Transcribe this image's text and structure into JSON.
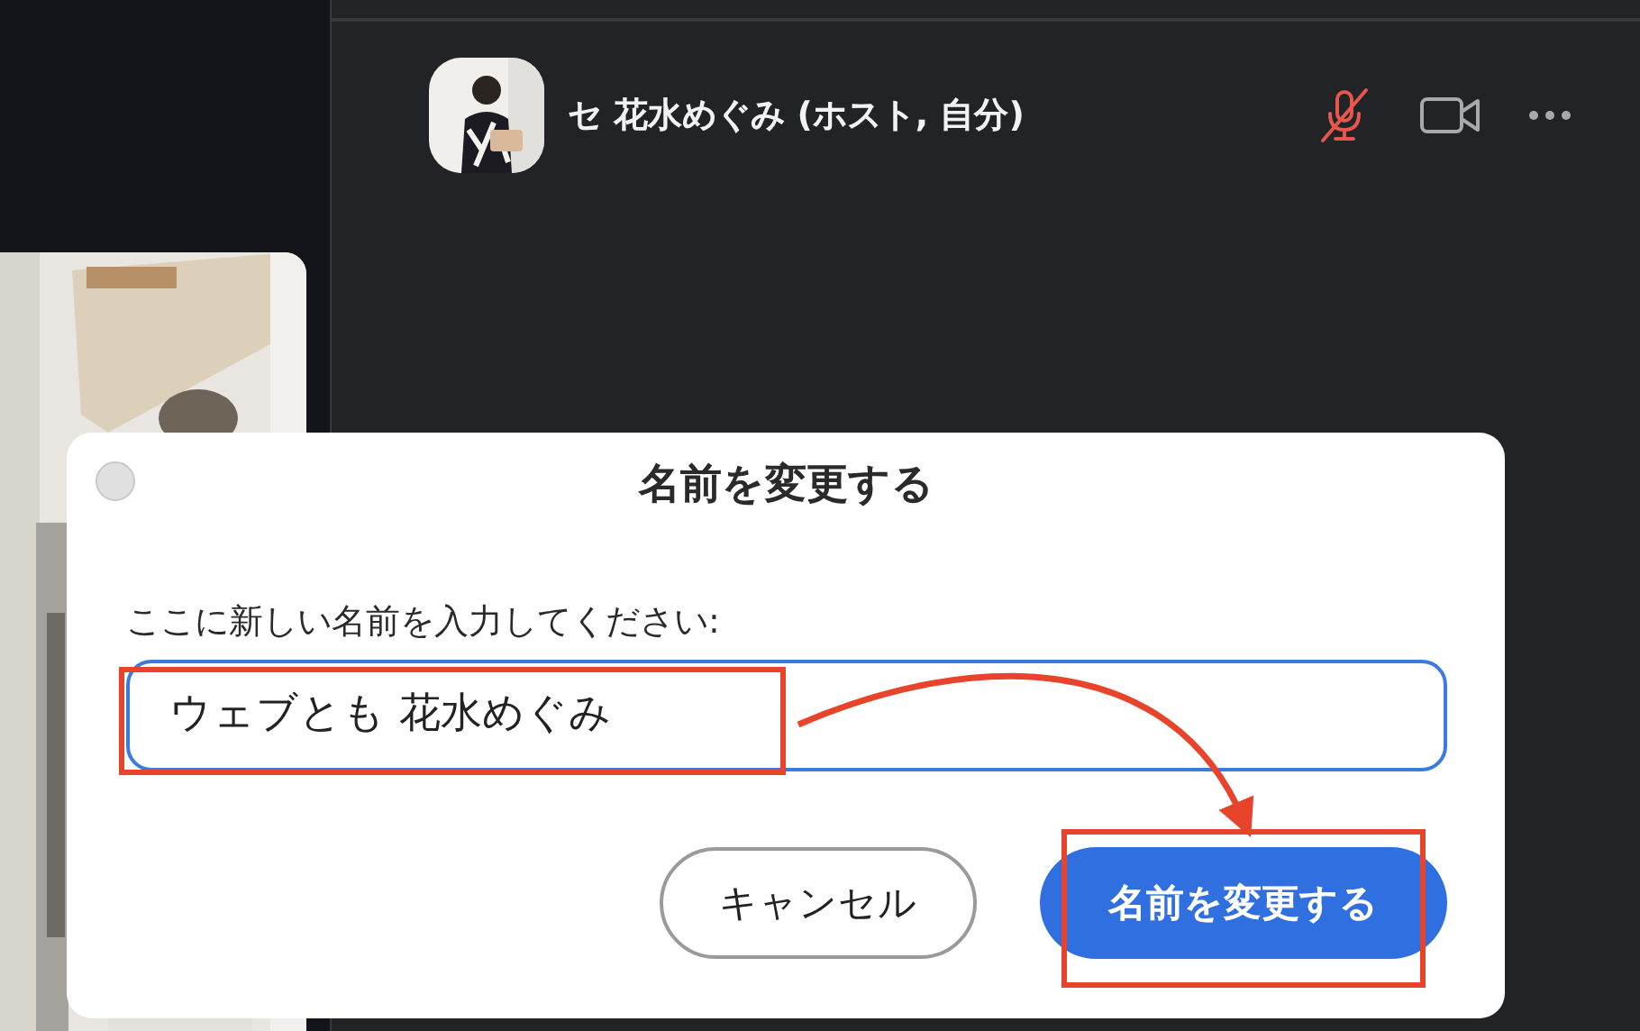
{
  "participant": {
    "name": "セ 花水めぐみ (ホスト, 自分)",
    "muted": true
  },
  "dialog": {
    "title": "名前を変更する",
    "label": "ここに新しい名前を入力してください:",
    "input": {
      "value": "ウェブとも 花水めぐみ"
    },
    "buttons": [
      {
        "label": "キャンセル",
        "kind": "cancel"
      },
      {
        "label": "名前を変更する",
        "kind": "primary"
      }
    ]
  }
}
